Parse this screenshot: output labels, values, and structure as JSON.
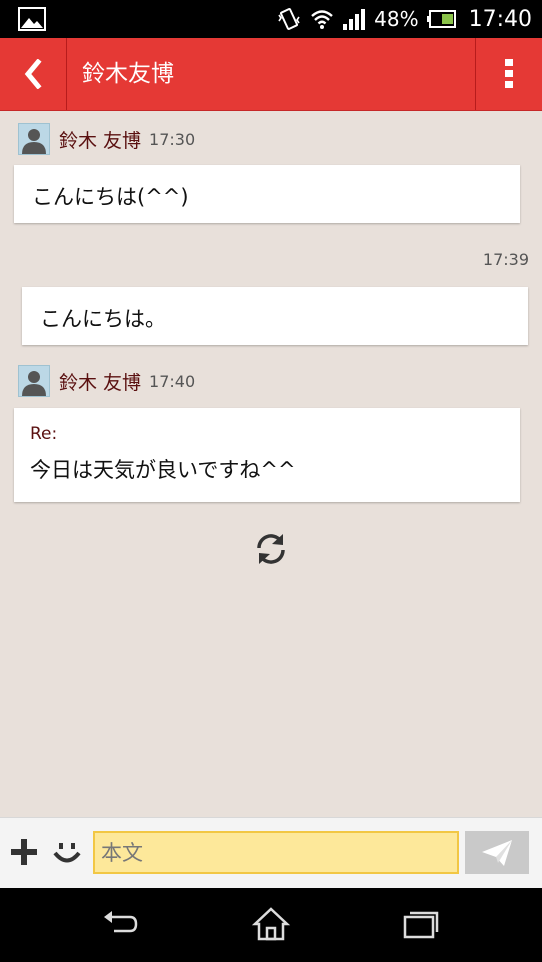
{
  "status_bar": {
    "battery": "48%",
    "time": "17:40",
    "icons": [
      "image-icon",
      "vibrate-icon",
      "wifi-icon",
      "signal-icon",
      "battery-icon"
    ]
  },
  "header": {
    "title": "鈴木友博",
    "color": "#e53935"
  },
  "messages": [
    {
      "direction": "in",
      "sender": "鈴木 友博",
      "time": "17:30",
      "text": "こんにちは(^^)"
    },
    {
      "direction": "out",
      "time": "17:39",
      "text": "こんにちは。"
    },
    {
      "direction": "in",
      "sender": "鈴木 友博",
      "time": "17:40",
      "reply_label": "Re:",
      "text": "今日は天気が良いですね^^"
    }
  ],
  "input": {
    "placeholder": "本文"
  }
}
